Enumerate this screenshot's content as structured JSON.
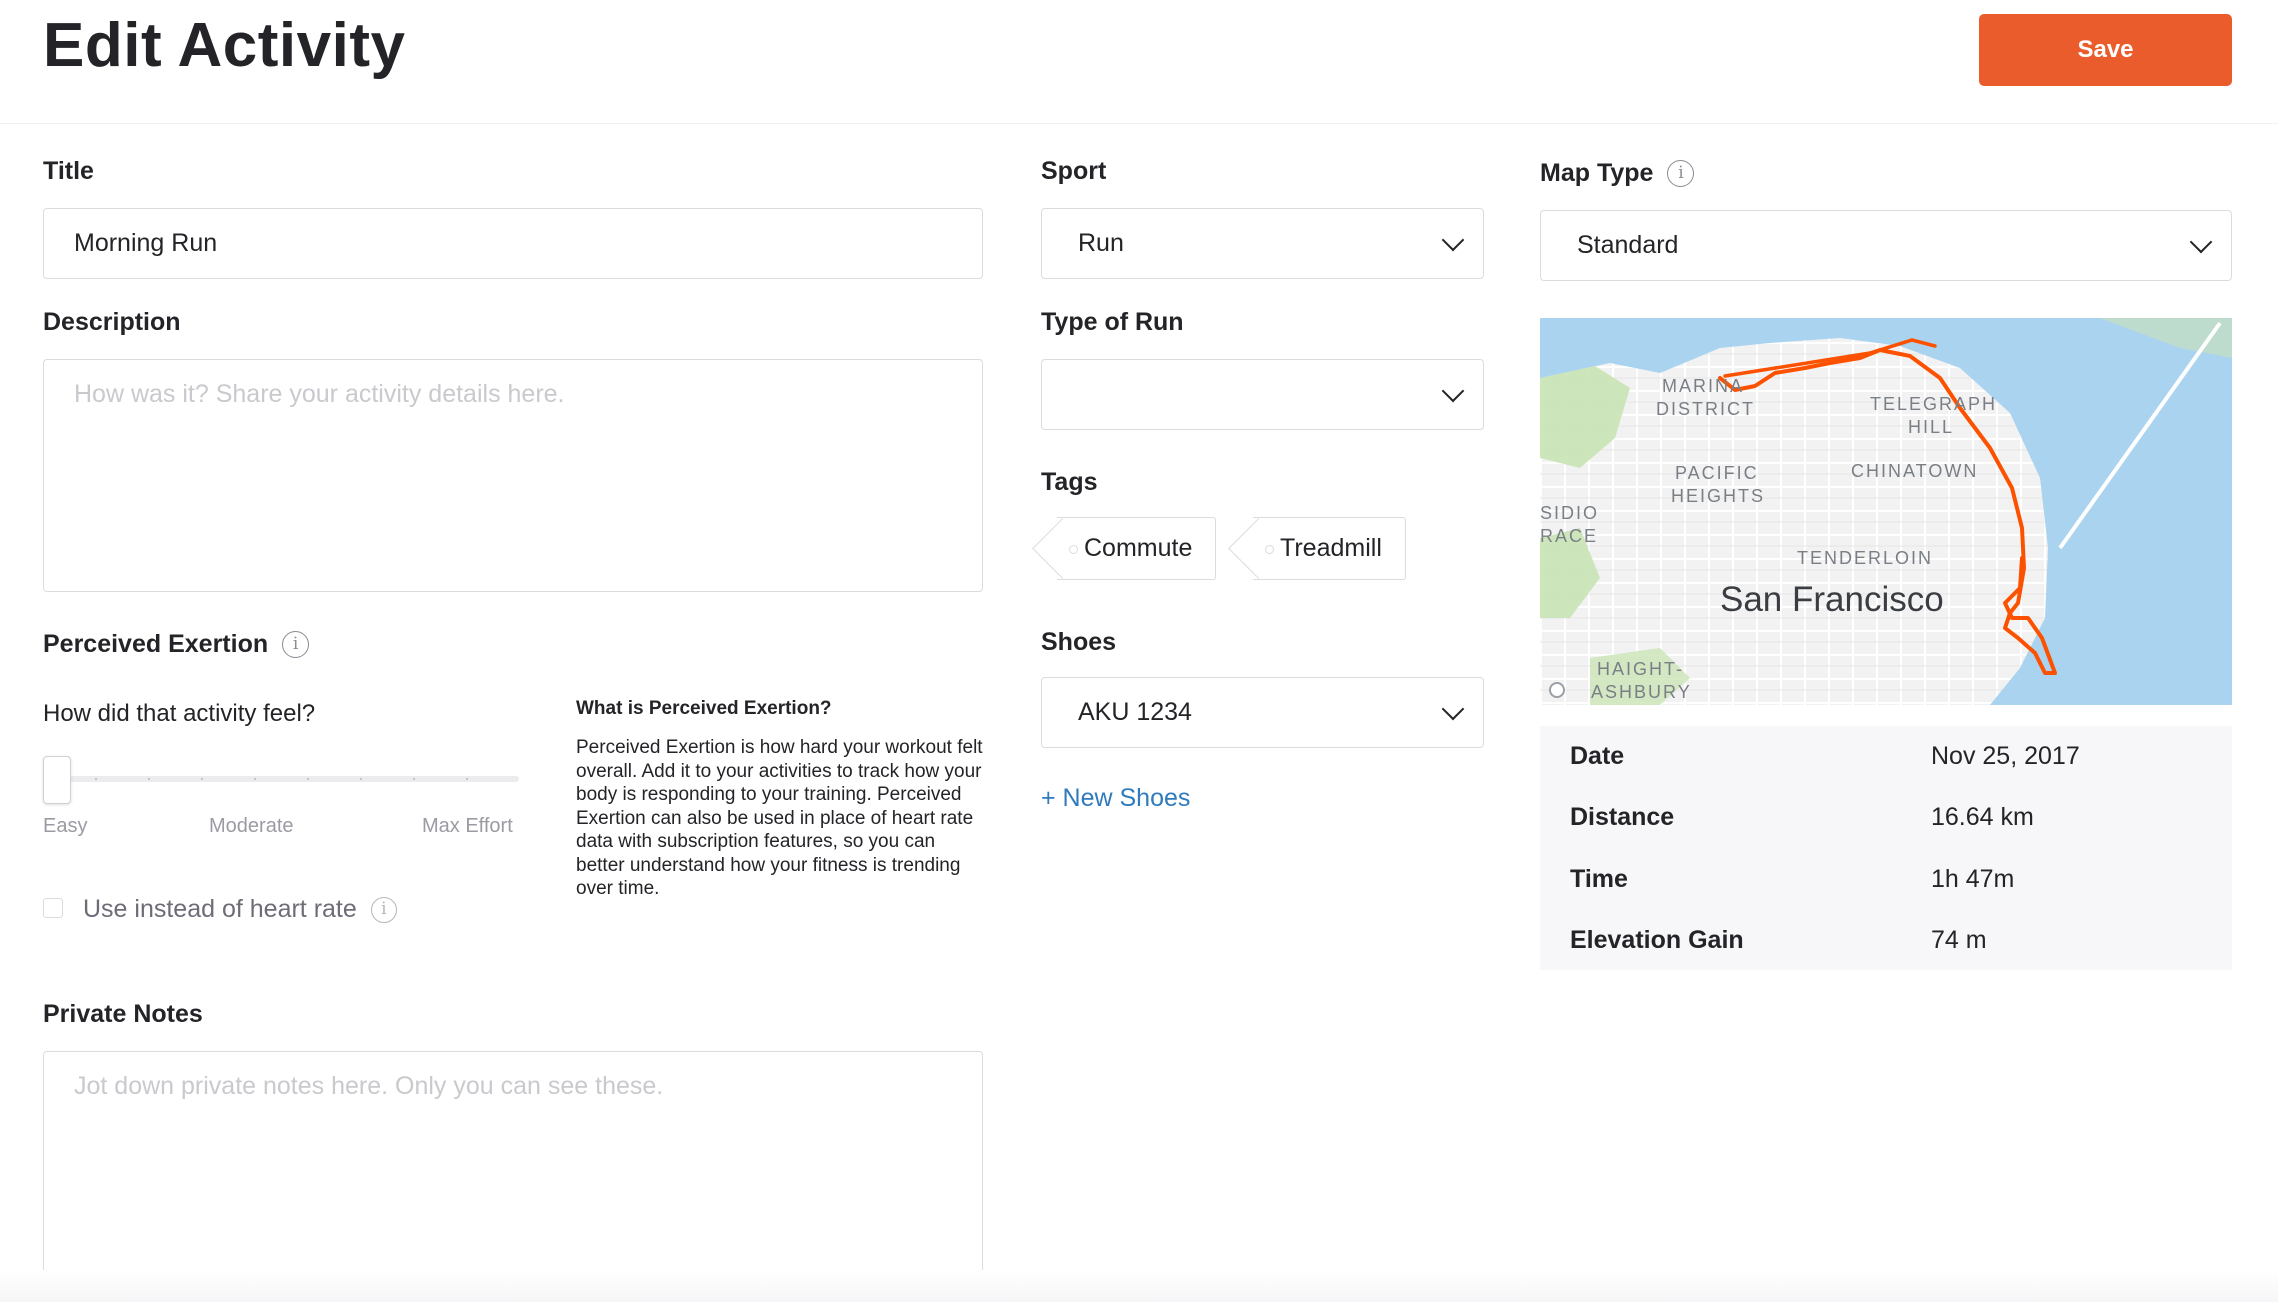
{
  "header": {
    "title": "Edit Activity",
    "save_label": "Save"
  },
  "title_field": {
    "label": "Title",
    "value": "Morning Run"
  },
  "description": {
    "label": "Description",
    "placeholder": "How was it? Share your activity details here."
  },
  "perceived_exertion": {
    "label": "Perceived Exertion",
    "question": "How did that activity feel?",
    "slider_value_fraction": 0,
    "scale_labels": [
      "Easy",
      "Moderate",
      "Max Effort"
    ],
    "checkbox_label": "Use instead of heart rate",
    "checkbox_checked": false,
    "help_title": "What is Perceived Exertion?",
    "help_text": "Perceived Exertion is how hard your workout felt overall. Add it to your activities to track how your body is responding to your training. Perceived Exertion can also be used in place of heart rate data with subscription features, so you can better understand how your fitness is trending over time."
  },
  "private_notes": {
    "label": "Private Notes",
    "placeholder": "Jot down private notes here. Only you can see these."
  },
  "sport": {
    "label": "Sport",
    "value": "Run"
  },
  "type_of_run": {
    "label": "Type of Run",
    "value": ""
  },
  "tags": {
    "label": "Tags",
    "items": [
      "Commute",
      "Treadmill"
    ]
  },
  "shoes": {
    "label": "Shoes",
    "value": "AKU 1234",
    "new_label": "+ New Shoes"
  },
  "map_type": {
    "label": "Map Type",
    "value": "Standard"
  },
  "map": {
    "labels": [
      "MARINA",
      "DISTRICT",
      "TELEGRAPH",
      "HILL",
      "PACIFIC",
      "HEIGHTS",
      "CHINATOWN",
      "SIDIO",
      "RACE",
      "TENDERLOIN",
      "HAIGHT-",
      "ASHBURY"
    ],
    "city": "San Francisco",
    "route_color": "#fc5200",
    "water_color": "#aad3f0"
  },
  "stats": [
    {
      "key": "Date",
      "value": "Nov 25, 2017"
    },
    {
      "key": "Distance",
      "value": "16.64 km"
    },
    {
      "key": "Time",
      "value": "1h 47m"
    },
    {
      "key": "Elevation Gain",
      "value": "74 m"
    }
  ],
  "colors": {
    "accent": "#ea5c2b",
    "link": "#2f7bbd"
  }
}
